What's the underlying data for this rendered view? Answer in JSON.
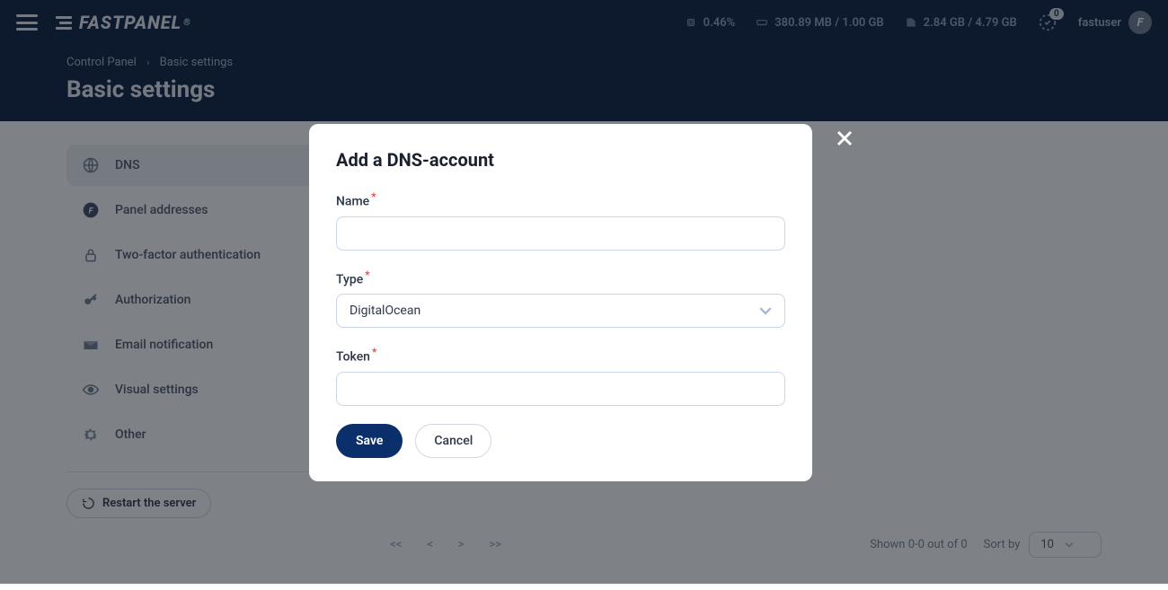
{
  "header": {
    "brand": "FASTPANEL",
    "stats": {
      "cpu": "0.46%",
      "ram": "380.89 MB / 1.00 GB",
      "disk": "2.84 GB / 4.79 GB"
    },
    "notifications": "0",
    "username": "fastuser",
    "avatar_initial": "F"
  },
  "breadcrumb": {
    "root": "Control Panel",
    "current": "Basic settings"
  },
  "page_title": "Basic settings",
  "sidebar": {
    "items": [
      {
        "label": "DNS"
      },
      {
        "label": "Panel addresses"
      },
      {
        "label": "Two-factor authentication"
      },
      {
        "label": "Authorization"
      },
      {
        "label": "Email notification"
      },
      {
        "label": "Visual settings"
      },
      {
        "label": "Other"
      }
    ],
    "restart_label": "Restart the server"
  },
  "pagination": {
    "first": "<<",
    "prev": "<",
    "next": ">",
    "last": ">>",
    "summary": "Shown 0-0 out of 0",
    "sort_label": "Sort by",
    "per_page": "10"
  },
  "modal": {
    "title": "Add a DNS-account",
    "name_label": "Name",
    "name_value": "",
    "type_label": "Type",
    "type_value": "DigitalOcean",
    "token_label": "Token",
    "token_value": "",
    "save_label": "Save",
    "cancel_label": "Cancel"
  }
}
